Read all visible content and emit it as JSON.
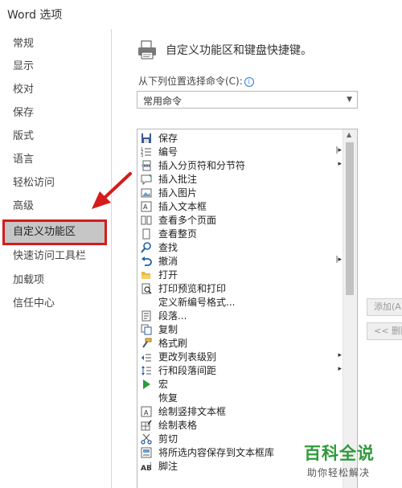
{
  "window": {
    "title": "Word 选项"
  },
  "sidebar": {
    "items": [
      {
        "label": "常规",
        "selected": false
      },
      {
        "label": "显示",
        "selected": false
      },
      {
        "label": "校对",
        "selected": false
      },
      {
        "label": "保存",
        "selected": false
      },
      {
        "label": "版式",
        "selected": false
      },
      {
        "label": "语言",
        "selected": false
      },
      {
        "label": "轻松访问",
        "selected": false
      },
      {
        "label": "高级",
        "selected": false
      },
      {
        "label": "自定义功能区",
        "selected": true
      },
      {
        "label": "快速访问工具栏",
        "selected": false
      },
      {
        "label": "加载项",
        "selected": false
      },
      {
        "label": "信任中心",
        "selected": false
      }
    ]
  },
  "main": {
    "header": "自定义功能区和键盘快捷键。",
    "choose_label": "从下列位置选择命令(C):",
    "choose_value": "常用命令",
    "commands": [
      {
        "label": "保存",
        "icon": "save-icon",
        "submenu": ""
      },
      {
        "label": "编号",
        "icon": "numbering-icon",
        "submenu": "|▸"
      },
      {
        "label": "插入分页符和分节符",
        "icon": "page-break-icon",
        "submenu": "▸"
      },
      {
        "label": "插入批注",
        "icon": "comment-icon",
        "submenu": ""
      },
      {
        "label": "插入图片",
        "icon": "picture-icon",
        "submenu": ""
      },
      {
        "label": "插入文本框",
        "icon": "textbox-icon",
        "submenu": ""
      },
      {
        "label": "查看多个页面",
        "icon": "multiple-pages-icon",
        "submenu": ""
      },
      {
        "label": "查看整页",
        "icon": "one-page-icon",
        "submenu": ""
      },
      {
        "label": "查找",
        "icon": "find-icon",
        "submenu": ""
      },
      {
        "label": "撤消",
        "icon": "undo-icon",
        "submenu": "|▸"
      },
      {
        "label": "打开",
        "icon": "open-folder-icon",
        "submenu": ""
      },
      {
        "label": "打印预览和打印",
        "icon": "print-preview-icon",
        "submenu": ""
      },
      {
        "label": "定义新编号格式...",
        "icon": "",
        "submenu": ""
      },
      {
        "label": "段落...",
        "icon": "paragraph-icon",
        "submenu": ""
      },
      {
        "label": "复制",
        "icon": "copy-icon",
        "submenu": ""
      },
      {
        "label": "格式刷",
        "icon": "format-painter-icon",
        "submenu": ""
      },
      {
        "label": "更改列表级别",
        "icon": "list-level-icon",
        "submenu": "▸"
      },
      {
        "label": "行和段落间距",
        "icon": "line-spacing-icon",
        "submenu": "▸"
      },
      {
        "label": "宏",
        "icon": "macro-icon",
        "submenu": ""
      },
      {
        "label": "恢复",
        "icon": "",
        "submenu": ""
      },
      {
        "label": "绘制竖排文本框",
        "icon": "vertical-textbox-icon",
        "submenu": ""
      },
      {
        "label": "绘制表格",
        "icon": "draw-table-icon",
        "submenu": ""
      },
      {
        "label": "剪切",
        "icon": "cut-icon",
        "submenu": ""
      },
      {
        "label": "将所选内容保存到文本框库",
        "icon": "save-to-gallery-icon",
        "submenu": ""
      },
      {
        "label": "脚注",
        "icon": "footnote-icon",
        "submenu": ""
      }
    ],
    "add_button": "添加(A) >>",
    "remove_button": "<< 删除(R)"
  },
  "watermark": {
    "main": "百科全说",
    "sub": "助你轻松解决"
  },
  "colors": {
    "accent_red": "#d41c1c",
    "selected_bg": "#c6c6c6",
    "watermark_green": "#2e9a3a"
  }
}
